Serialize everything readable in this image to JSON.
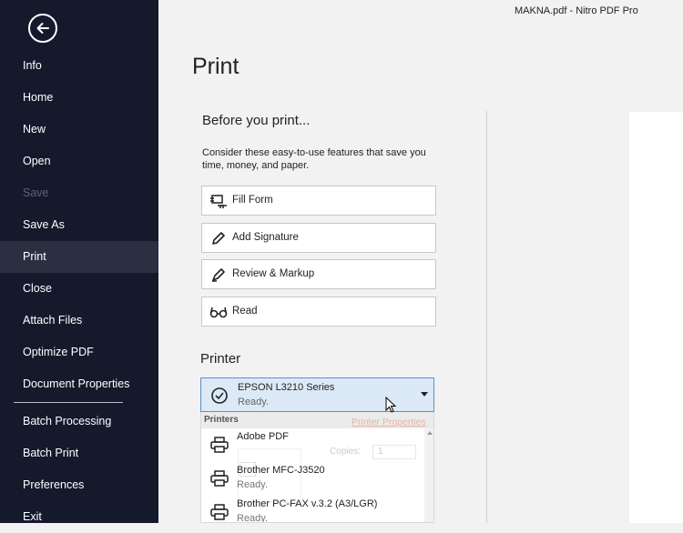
{
  "window": {
    "title": "MAKNA.pdf - Nitro PDF Pro"
  },
  "sidebar": {
    "items": [
      {
        "label": "Info"
      },
      {
        "label": "Home"
      },
      {
        "label": "New"
      },
      {
        "label": "Open"
      },
      {
        "label": "Save"
      },
      {
        "label": "Save As"
      },
      {
        "label": "Print"
      },
      {
        "label": "Close"
      },
      {
        "label": "Attach Files"
      },
      {
        "label": "Optimize PDF"
      },
      {
        "label": "Document Properties"
      },
      {
        "label": "Batch Processing"
      },
      {
        "label": "Batch Print"
      },
      {
        "label": "Preferences"
      },
      {
        "label": "Exit"
      }
    ]
  },
  "main": {
    "title": "Print",
    "before": {
      "heading": "Before you print...",
      "hint": "Consider these easy-to-use features that save you time, money, and paper.",
      "buttons": [
        {
          "label": "Fill Form",
          "icon": "fill-form-icon"
        },
        {
          "label": "Add Signature",
          "icon": "pen-icon"
        },
        {
          "label": "Review & Markup",
          "icon": "highlighter-icon"
        },
        {
          "label": "Read",
          "icon": "glasses-icon"
        }
      ]
    },
    "printer": {
      "heading": "Printer",
      "selected": {
        "name": "EPSON L3210 Series",
        "status": "Ready."
      },
      "dropdown": {
        "group_label": "Printers",
        "items": [
          {
            "name": "Adobe PDF",
            "status": ""
          },
          {
            "name": "Brother MFC-J3520",
            "status": "Ready."
          },
          {
            "name": "Brother PC-FAX v.3.2 (A3/LGR)",
            "status": "Ready."
          }
        ]
      },
      "properties_link": "Printer Properties",
      "copies_label": "Copies:",
      "copies_value": "1"
    }
  },
  "colors": {
    "sidebar_bg": "#141a2c",
    "active_item": "#2a3042",
    "select_bg": "#dce9f6",
    "select_border": "#5a93c9"
  }
}
